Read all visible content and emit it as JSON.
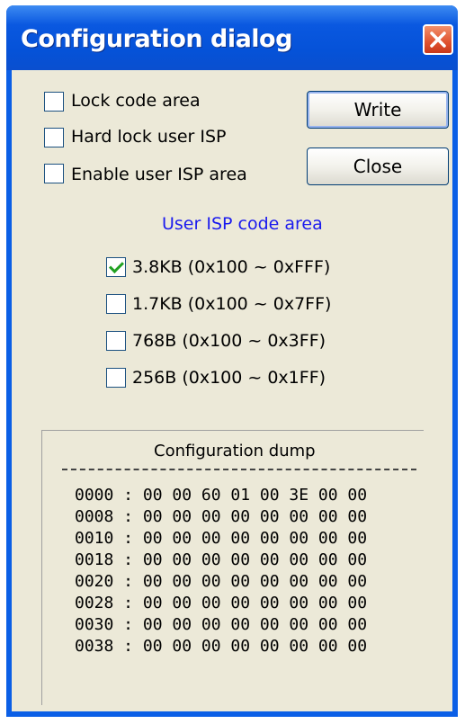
{
  "window": {
    "title": "Configuration dialog"
  },
  "options": [
    {
      "label": "Lock code area",
      "checked": false
    },
    {
      "label": "Hard lock user ISP",
      "checked": false
    },
    {
      "label": "Enable user ISP area",
      "checked": false
    }
  ],
  "buttons": {
    "write": "Write",
    "close": "Close"
  },
  "isp": {
    "title": "User ISP code area",
    "title_color": "#1a1aee",
    "options": [
      {
        "label": "3.8KB (0x100 ~ 0xFFF)",
        "checked": true
      },
      {
        "label": "1.7KB (0x100 ~ 0x7FF)",
        "checked": false
      },
      {
        "label": "768B (0x100 ~ 0x3FF)",
        "checked": false
      },
      {
        "label": "256B (0x100 ~ 0x1FF)",
        "checked": false
      }
    ]
  },
  "dump": {
    "title": "Configuration dump",
    "rows": [
      "0000 : 00 00 60 01 00 3E 00 00",
      "0008 : 00 00 00 00 00 00 00 00",
      "0010 : 00 00 00 00 00 00 00 00",
      "0018 : 00 00 00 00 00 00 00 00",
      "0020 : 00 00 00 00 00 00 00 00",
      "0028 : 00 00 00 00 00 00 00 00",
      "0030 : 00 00 00 00 00 00 00 00",
      "0038 : 00 00 00 00 00 00 00 00"
    ]
  },
  "icons": {
    "close": "close-x-icon",
    "check": "checkmark-icon"
  }
}
